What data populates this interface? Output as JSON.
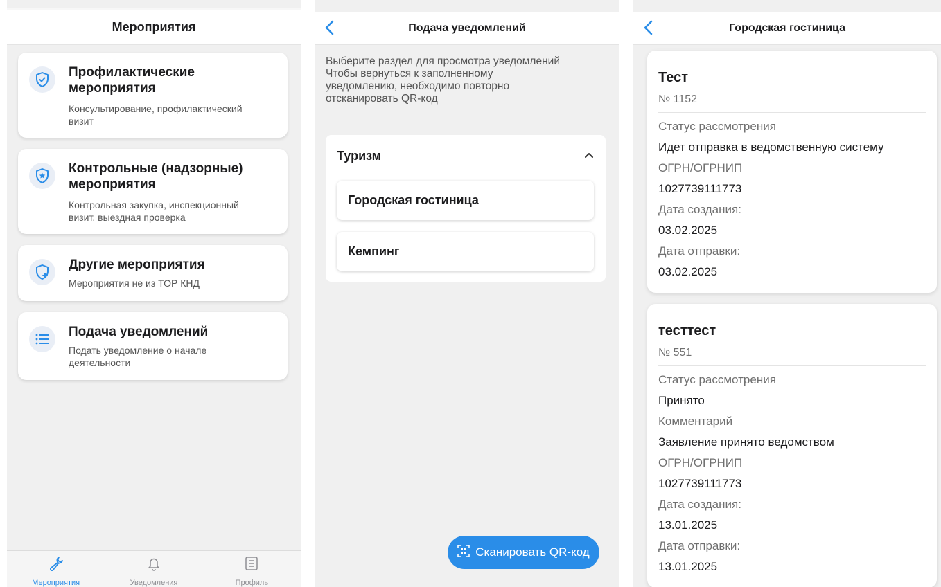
{
  "screen_events": {
    "title": "Мероприятия",
    "cards": [
      {
        "title_line1": "Профилактические",
        "title_line2": "мероприятия",
        "desc_line1": "Консультирование, профилактический",
        "desc_line2": "визит",
        "icon": "shield-check-icon"
      },
      {
        "title_line1": "Контрольные (надзорные)",
        "title_line2": "мероприятия",
        "desc_line1": "Контрольная закупка, инспекционный",
        "desc_line2": "визит, выездная проверка",
        "icon": "shield-star-icon"
      },
      {
        "title_line1": "Другие мероприятия",
        "desc_line1": "Мероприятия не из ТОР КНД",
        "icon": "shield-plus-icon"
      },
      {
        "title_line1": "Подача уведомлений",
        "desc_line1": "Подать уведомление о начале",
        "desc_line2": "деятельности",
        "icon": "list-icon"
      }
    ],
    "tabs": [
      {
        "label": "Мероприятия",
        "icon": "wrench-icon",
        "active": true
      },
      {
        "label": "Уведомления",
        "icon": "bell-icon",
        "active": false
      },
      {
        "label": "Профиль",
        "icon": "profile-list-icon",
        "active": false
      }
    ]
  },
  "screen_notifications": {
    "title": "Подача уведомлений",
    "hint_lines": [
      "Выберите раздел для просмотра уведомлений",
      "Чтобы вернуться к заполненному",
      "уведомлению, необходимо повторно",
      "отсканировать QR-код"
    ],
    "group_title": "Туризм",
    "items": [
      "Городская гостиница",
      "Кемпинг"
    ],
    "scan_button": "Сканировать QR-код"
  },
  "screen_hotel": {
    "title": "Городская гостиница",
    "notices": [
      {
        "name": "Тест",
        "number": "№ 1152",
        "status_label": "Статус рассмотрения",
        "status_value": "Идет отправка в ведомственную систему",
        "ogrn_label": "ОГРН/ОГРНИП",
        "ogrn_value": "1027739111773",
        "created_label": "Дата создания:",
        "created_value": "03.02.2025",
        "sent_label": "Дата отправки:",
        "sent_value": "03.02.2025"
      },
      {
        "name": "тесттест",
        "number": "№ 551",
        "status_label": "Статус рассмотрения",
        "status_value": "Принято",
        "comment_label": "Комментарий",
        "comment_value": "Заявление принято ведомством",
        "ogrn_label": "ОГРН/ОГРНИП",
        "ogrn_value": "1027739111773",
        "created_label": "Дата создания:",
        "created_value": "13.01.2025",
        "sent_label": "Дата отправки:",
        "sent_value": "13.01.2025"
      }
    ]
  },
  "colors": {
    "accent": "#2a8de8",
    "background": "#f0f0f0",
    "card": "#ffffff",
    "muted_text": "#707070"
  }
}
